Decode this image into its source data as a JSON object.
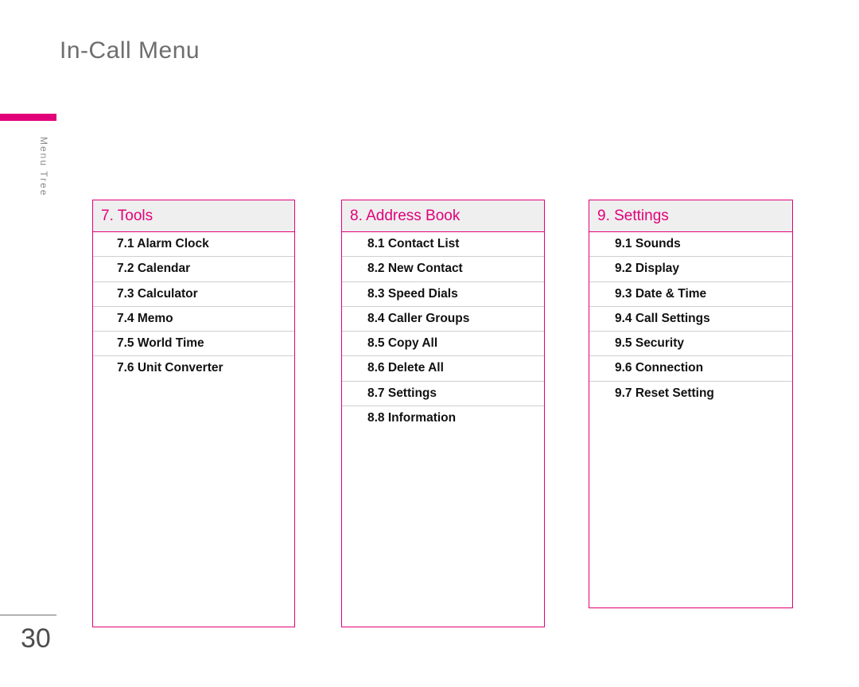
{
  "page": {
    "title": "In-Call Menu",
    "number": "30",
    "side_label": "Menu Tree",
    "accent_color": "#e2007a",
    "header_bg": "#efefef"
  },
  "columns": [
    {
      "header": "7. Tools",
      "items": [
        "7.1 Alarm Clock",
        "7.2 Calendar",
        "7.3 Calculator",
        "7.4 Memo",
        "7.5 World Time",
        "7.6 Unit Converter"
      ]
    },
    {
      "header": "8. Address Book",
      "items": [
        "8.1 Contact List",
        "8.2 New Contact",
        "8.3 Speed Dials",
        "8.4 Caller Groups",
        "8.5 Copy All",
        "8.6 Delete All",
        "8.7 Settings",
        "8.8 Information"
      ]
    },
    {
      "header": "9. Settings",
      "items": [
        "9.1 Sounds",
        "9.2 Display",
        "9.3 Date & Time",
        "9.4 Call Settings",
        "9.5 Security",
        "9.6 Connection",
        "9.7 Reset Setting"
      ]
    }
  ]
}
